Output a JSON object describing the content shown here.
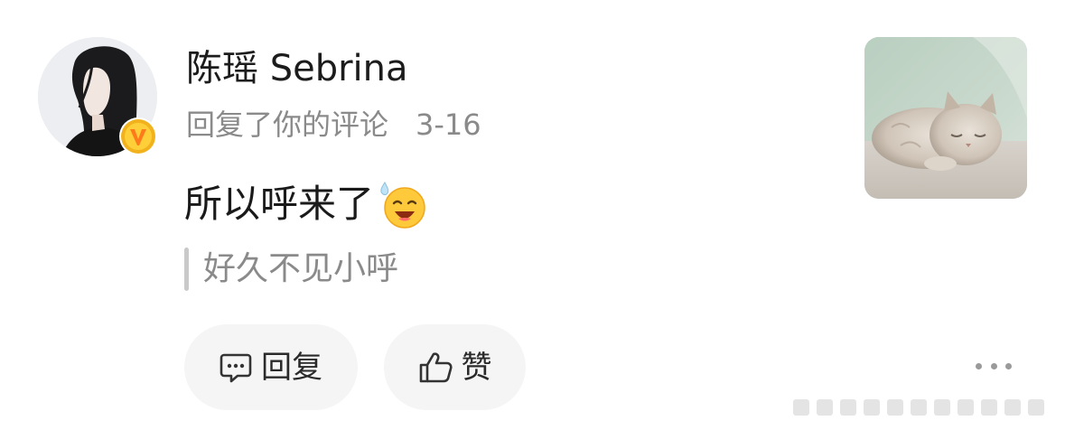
{
  "comment_card": {
    "author_name": "陈瑶 Sebrina",
    "action_text": "回复了你的评论",
    "date": "3-16",
    "comment_text": "所以呼来了",
    "emoji_name": "laughing-sweat-emoji",
    "quoted_text": "好久不见小呼",
    "reply_label": "回复",
    "like_label": "赞",
    "attached_image_subject": "sleeping-cat",
    "badge": "verified-v-badge"
  },
  "colors": {
    "badge_gold": "#f2b21d",
    "badge_orange": "#ff7a1a",
    "muted_text": "#8a8a8a",
    "pill_bg": "#f5f5f5"
  }
}
